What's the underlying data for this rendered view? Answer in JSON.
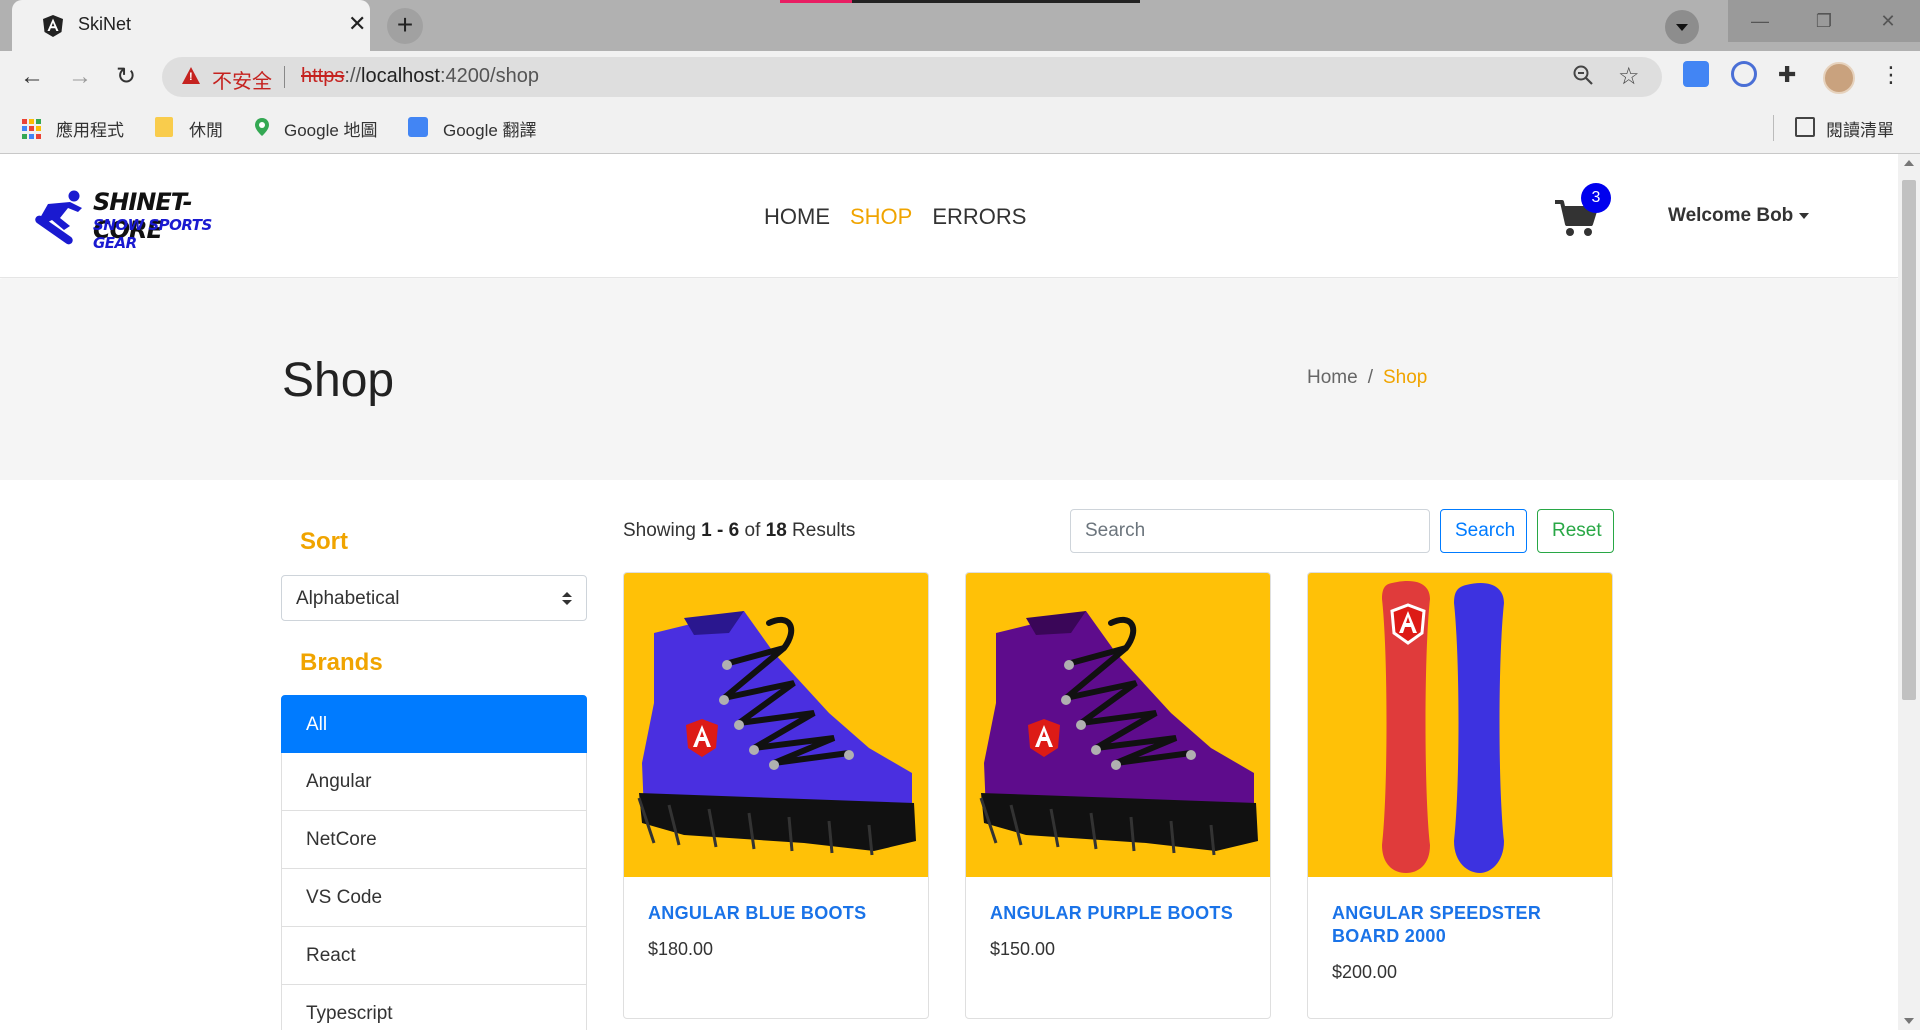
{
  "browser": {
    "tab_title": "SkiNet",
    "tab_close": "✕",
    "new_tab": "+",
    "insecure_label": "不安全",
    "url_scheme": "https",
    "url_sep": "://",
    "url_host": "localhost",
    "url_path": ":4200/shop",
    "bookmarks": [
      "應用程式",
      "休閒",
      "Google 地圖",
      "Google 翻譯"
    ],
    "reading_list": "閱讀清單"
  },
  "site": {
    "logo_line1": "SHINET-CORE",
    "logo_line2": "SNOW SPORTS GEAR",
    "nav": [
      "HOME",
      "SHOP",
      "ERRORS"
    ],
    "active_nav": "SHOP",
    "cart_count": "3",
    "welcome": "Welcome Bob"
  },
  "hero": {
    "title": "Shop",
    "breadcrumb_home": "Home",
    "breadcrumb_sep": "/",
    "breadcrumb_current": "Shop"
  },
  "sidebar": {
    "sort_title": "Sort",
    "sort_selected": "Alphabetical",
    "brands_title": "Brands",
    "brands": [
      "All",
      "Angular",
      "NetCore",
      "VS Code",
      "React",
      "Typescript"
    ],
    "active_brand": "All"
  },
  "results": {
    "prefix": "Showing ",
    "from": "1",
    "dash": " - ",
    "to": "6",
    "of": " of ",
    "total": "18",
    "suffix": " Results"
  },
  "search": {
    "placeholder": "Search",
    "search_label": "Search",
    "reset_label": "Reset"
  },
  "products": [
    {
      "name": "Angular Blue Boots",
      "price": "$180.00",
      "image": "blue-boot",
      "color": "#4a2fe0"
    },
    {
      "name": "Angular Purple Boots",
      "price": "$150.00",
      "image": "purple-boot",
      "color": "#5e0c8c"
    },
    {
      "name": "Angular Speedster Board 2000",
      "price": "$200.00",
      "image": "snowboards",
      "color": "#e03b3b"
    }
  ],
  "colors": {
    "accent": "#f0a400",
    "primary": "#007bff",
    "success": "#28a745",
    "card_bg": "#ffc107"
  }
}
